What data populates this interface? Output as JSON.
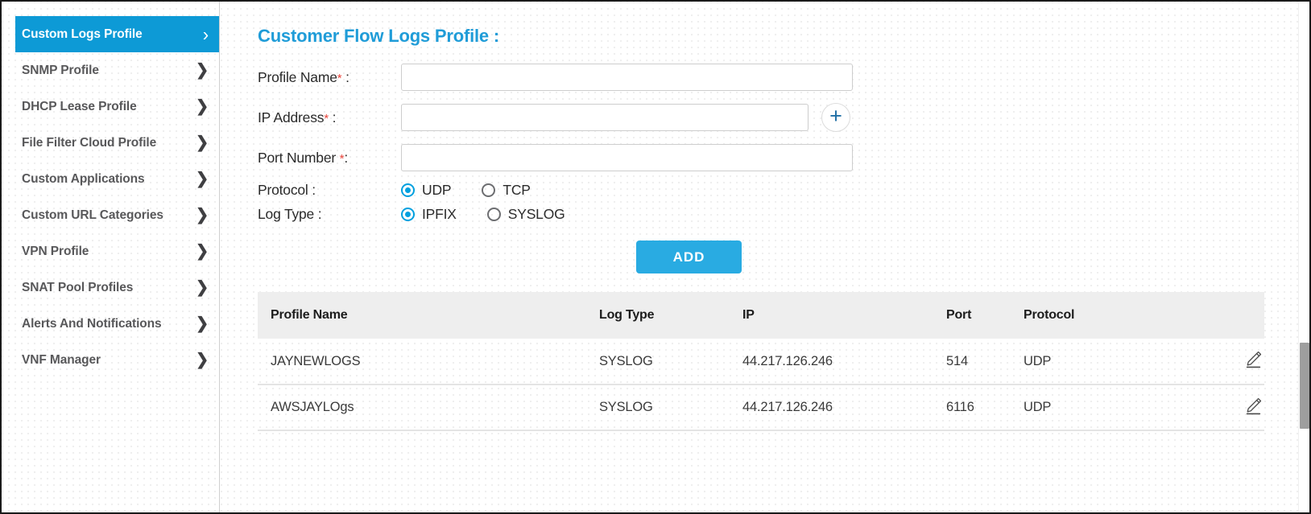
{
  "sidebar": {
    "items": [
      {
        "label": "Custom Logs Profile",
        "icon": "chevron-right-icon",
        "active": true
      },
      {
        "label": "SNMP Profile",
        "icon": "chevron-right-icon",
        "active": false
      },
      {
        "label": "DHCP Lease Profile",
        "icon": "chevron-right-icon",
        "active": false
      },
      {
        "label": "File Filter Cloud Profile",
        "icon": "chevron-right-icon",
        "active": false
      },
      {
        "label": "Custom Applications",
        "icon": "chevron-right-icon",
        "active": false
      },
      {
        "label": "Custom URL Categories",
        "icon": "chevron-right-icon",
        "active": false
      },
      {
        "label": "VPN Profile",
        "icon": "chevron-right-icon",
        "active": false
      },
      {
        "label": "SNAT Pool Profiles",
        "icon": "chevron-right-icon",
        "active": false
      },
      {
        "label": "Alerts And Notifications",
        "icon": "chevron-right-icon",
        "active": false
      },
      {
        "label": "VNF Manager",
        "icon": "chevron-right-icon",
        "active": false
      }
    ],
    "active_accent_color": "#0d9ad6"
  },
  "main": {
    "title": "Customer Flow Logs Profile :",
    "title_color": "#1f9cd8",
    "form": {
      "profile_name": {
        "label": "Profile Name",
        "required_marker": "*",
        "label_suffix": ":",
        "value": "",
        "placeholder": ""
      },
      "ip_address": {
        "label": "IP Address",
        "required_marker": "*",
        "label_suffix": ":",
        "value": "",
        "placeholder": "",
        "add_icon": "plus-icon",
        "add_icon_color": "#1f6fa5"
      },
      "port_number": {
        "label": "Port Number",
        "required_marker": "*",
        "label_suffix": ":",
        "value": "",
        "placeholder": ""
      },
      "protocol": {
        "label": "Protocol :",
        "selected": "UDP",
        "options": [
          {
            "label": "UDP",
            "selected": true
          },
          {
            "label": "TCP",
            "selected": false
          }
        ]
      },
      "log_type": {
        "label": "Log Type :",
        "selected": "IPFIX",
        "options": [
          {
            "label": "IPFIX",
            "selected": true
          },
          {
            "label": "SYSLOG",
            "selected": false
          }
        ]
      },
      "submit": {
        "label": "ADD",
        "color": "#29abe2"
      }
    },
    "table": {
      "columns": [
        "Profile Name",
        "Log Type",
        "IP",
        "Port",
        "Protocol",
        ""
      ],
      "rows": [
        {
          "profile_name": "JAYNEWLOGS",
          "log_type": "SYSLOG",
          "ip": "44.217.126.246",
          "port": "514",
          "protocol": "UDP",
          "action_icon": "pencil-edit-icon"
        },
        {
          "profile_name": "AWSJAYLOgs",
          "log_type": "SYSLOG",
          "ip": "44.217.126.246",
          "port": "6116",
          "protocol": "UDP",
          "action_icon": "pencil-edit-icon"
        }
      ]
    }
  },
  "scrollbar": {
    "orientation": "vertical",
    "thumb_color": "#9e9e9e"
  }
}
